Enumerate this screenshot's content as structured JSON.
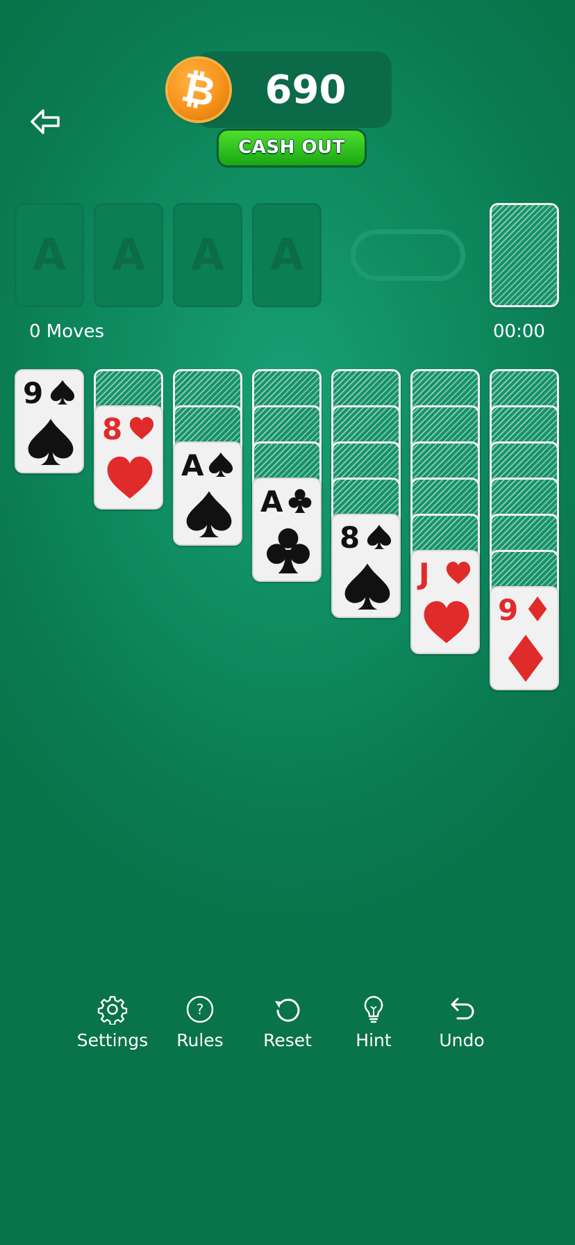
{
  "header": {
    "coin_symbol": "₿",
    "coin_value": "690",
    "cashout_label": "CASH OUT"
  },
  "foundations": [
    {
      "label": "A"
    },
    {
      "label": "A"
    },
    {
      "label": "A"
    },
    {
      "label": "A"
    }
  ],
  "status": {
    "moves": "0 Moves",
    "timer": "00:00"
  },
  "tableau": [
    {
      "face_down": 0,
      "top": {
        "rank": "9",
        "suit": "spades",
        "color": "black"
      }
    },
    {
      "face_down": 1,
      "top": {
        "rank": "8",
        "suit": "hearts",
        "color": "red"
      }
    },
    {
      "face_down": 2,
      "top": {
        "rank": "A",
        "suit": "spades",
        "color": "black"
      }
    },
    {
      "face_down": 3,
      "top": {
        "rank": "A",
        "suit": "clubs",
        "color": "black"
      }
    },
    {
      "face_down": 4,
      "top": {
        "rank": "8",
        "suit": "spades",
        "color": "black"
      }
    },
    {
      "face_down": 5,
      "top": {
        "rank": "J",
        "suit": "hearts",
        "color": "red"
      }
    },
    {
      "face_down": 6,
      "top": {
        "rank": "9",
        "suit": "diamonds",
        "color": "red"
      }
    }
  ],
  "toolbar": {
    "settings": "Settings",
    "rules": "Rules",
    "reset": "Reset",
    "hint": "Hint",
    "undo": "Undo"
  },
  "colors": {
    "felt": "#0f8a5f",
    "card_red": "#e02b2b",
    "card_black": "#111111",
    "coin": "#f7931a",
    "cashout": "#2fc21c"
  }
}
